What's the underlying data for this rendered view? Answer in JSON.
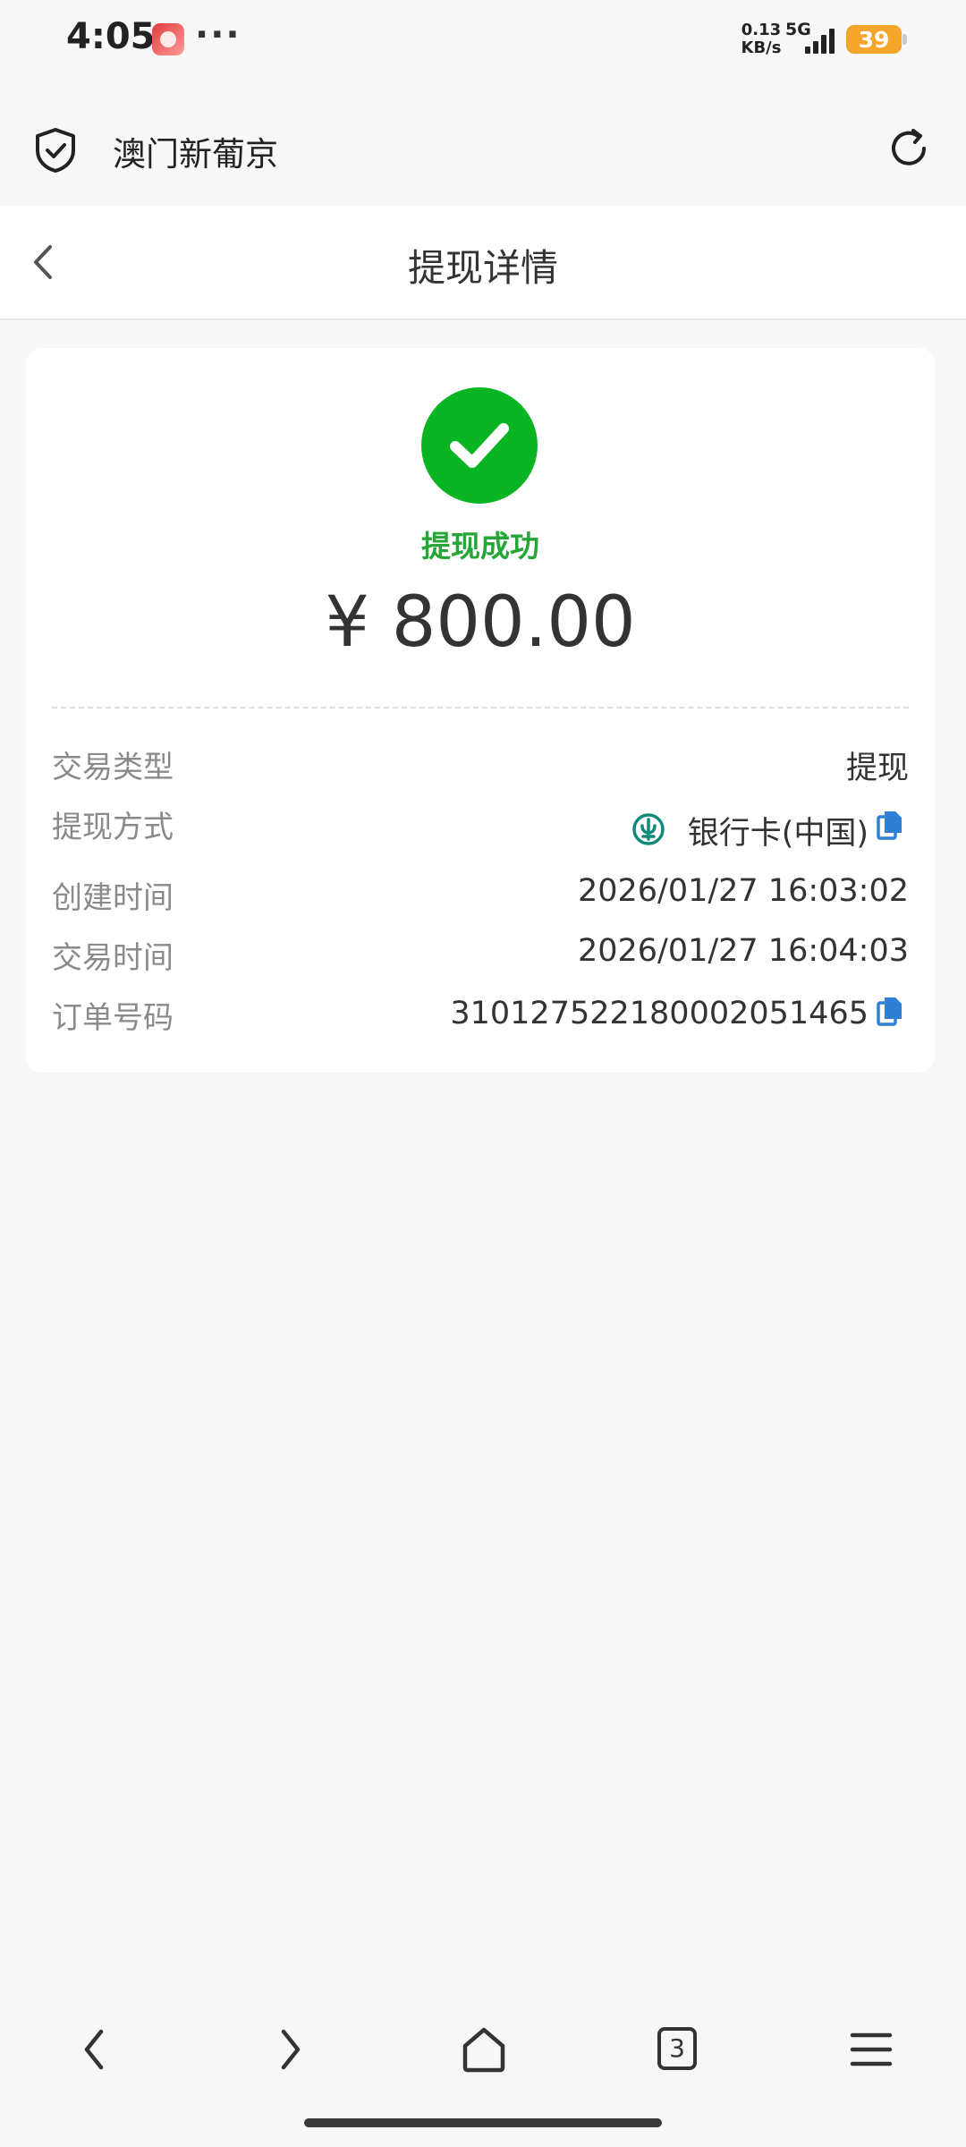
{
  "status_bar": {
    "time": "4:05",
    "dots": "···",
    "speed_value": "0.13",
    "speed_unit": "KB/s",
    "network": "5G",
    "battery": "39"
  },
  "browser": {
    "site_name": "澳门新葡京",
    "shield_icon": "shield-check-icon",
    "refresh_icon": "refresh-icon"
  },
  "header": {
    "title": "提现详情",
    "back_icon": "chevron-left-icon"
  },
  "summary": {
    "status_text": "提现成功",
    "amount": "¥ 800.00",
    "status_color": "#0ab524"
  },
  "details": {
    "type_label": "交易类型",
    "type_value": "提现",
    "method_label": "提现方式",
    "method_value": "银行卡(中国)",
    "created_label": "创建时间",
    "created_value": "2026/01/27 16:03:02",
    "trade_time_label": "交易时间",
    "trade_time_value": "2026/01/27 16:04:03",
    "order_label": "订单号码",
    "order_value": "310127522180002051465"
  },
  "bottom_nav": {
    "tab_count": "3",
    "icons": [
      "chevron-left-icon",
      "chevron-right-icon",
      "home-icon",
      "tabs-icon",
      "menu-icon"
    ]
  },
  "colors": {
    "accent_blue": "#2f7fd6",
    "bank_teal": "#0e8a7a",
    "success_green": "#25a636"
  }
}
